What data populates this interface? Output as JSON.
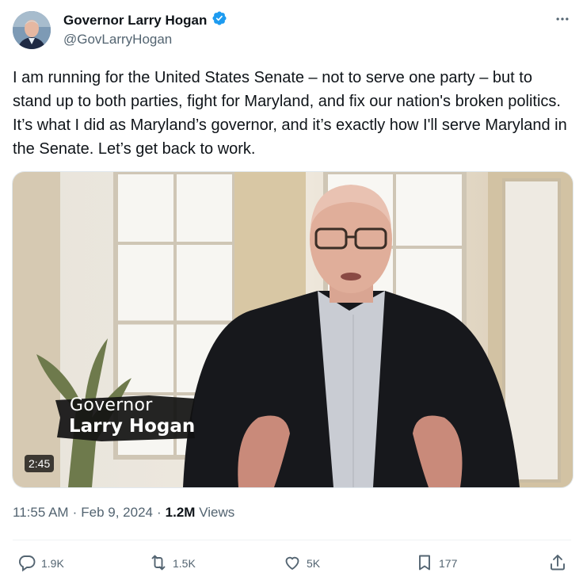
{
  "author": {
    "display_name": "Governor Larry Hogan",
    "handle": "@GovLarryHogan",
    "verified": true
  },
  "tweet": {
    "text": "I am running for the United States Senate – not to serve one party – but to stand up to both parties, fight for Maryland, and fix our nation's broken politics. It’s what I did as Maryland’s governor, and it’s exactly how I'll serve Maryland in the Senate. Let’s get back to work."
  },
  "media": {
    "caption_line1": "Governor",
    "caption_line2": "Larry Hogan",
    "duration": "2:45"
  },
  "meta": {
    "time": "11:55 AM",
    "sep1": "·",
    "date": "Feb 9, 2024",
    "sep2": "·",
    "views_count": "1.2M",
    "views_label": "Views"
  },
  "actions": {
    "replies": "1.9K",
    "reposts": "1.5K",
    "likes": "5K",
    "bookmarks": "177"
  },
  "colors": {
    "verified": "#1d9bf0",
    "text": "#0f1419",
    "secondary": "#536471"
  },
  "icons": [
    "verified-badge-icon",
    "more-options-icon",
    "reply-icon",
    "repost-icon",
    "like-icon",
    "bookmark-icon",
    "share-icon"
  ]
}
